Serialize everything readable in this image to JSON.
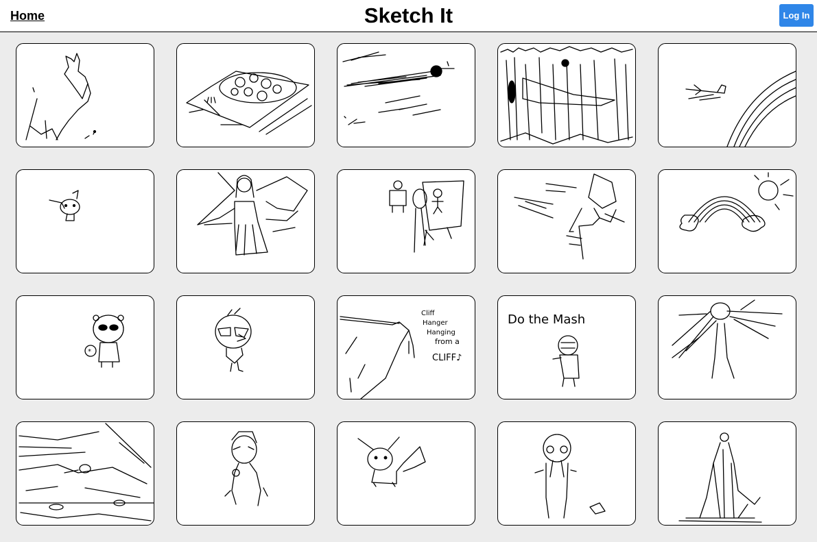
{
  "header": {
    "home_label": "Home",
    "title": "Sketch It",
    "login_label": "Log In",
    "login_color": "#2f86e8"
  },
  "sketches": [
    {
      "name": "dragon-sketch"
    },
    {
      "name": "pizza-sketch"
    },
    {
      "name": "flying-person-sketch"
    },
    {
      "name": "stormy-house-sketch"
    },
    {
      "name": "airplane-rainbow-sketch"
    },
    {
      "name": "pichu-sketch"
    },
    {
      "name": "bride-sketch"
    },
    {
      "name": "painter-easel-sketch"
    },
    {
      "name": "running-figure-sketch"
    },
    {
      "name": "rainbow-sun-sketch"
    },
    {
      "name": "bear-character-sketch"
    },
    {
      "name": "bird-sunglasses-sketch"
    },
    {
      "name": "cliff-hanger-sketch",
      "text_lines": [
        "Cliff",
        "Hanger",
        "Hanging",
        "from a",
        "CLIFF♪"
      ]
    },
    {
      "name": "mummy-mash-sketch",
      "text": "Do the Mash"
    },
    {
      "name": "long-hair-girl-sketch"
    },
    {
      "name": "landscape-sketch"
    },
    {
      "name": "boy-sketch"
    },
    {
      "name": "eevee-sketch"
    },
    {
      "name": "crying-character-sketch"
    },
    {
      "name": "cloaked-figure-sketch"
    }
  ]
}
